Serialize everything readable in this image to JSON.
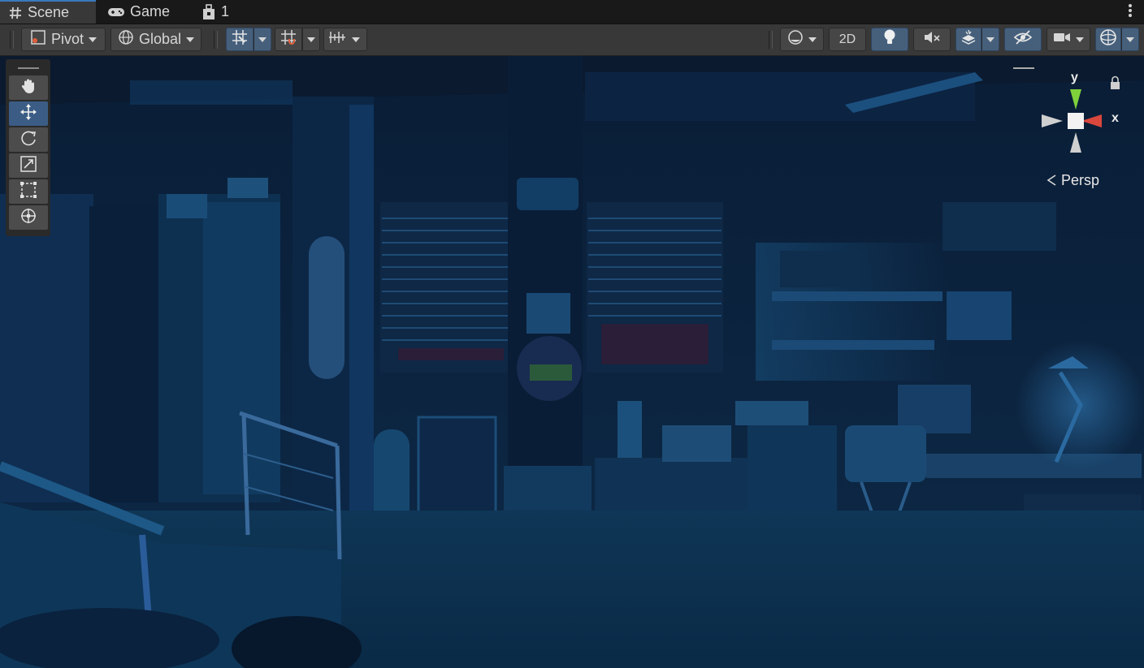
{
  "tabs": {
    "scene_label": "Scene",
    "game_label": "Game",
    "extra_label": "1"
  },
  "toolbar": {
    "pivot_label": "Pivot",
    "global_label": "Global",
    "mode_2d_label": "2D"
  },
  "gizmo": {
    "y_label": "y",
    "x_label": "x",
    "projection_label": "Persp"
  },
  "colors": {
    "accent": "#3a79bb",
    "toggle_on": "#46607c",
    "axis_y": "#7fd13b",
    "axis_x": "#d9473d"
  },
  "icons": {
    "scene_tab": "hash-icon",
    "game_tab": "gamepad-icon",
    "extra_tab": "package-icon",
    "hand_tool": "hand-icon",
    "move_tool": "move-icon",
    "rotate_tool": "rotate-icon",
    "scale_tool": "scale-icon",
    "rect_tool": "rect-icon",
    "transform_tool": "transform-icon"
  }
}
